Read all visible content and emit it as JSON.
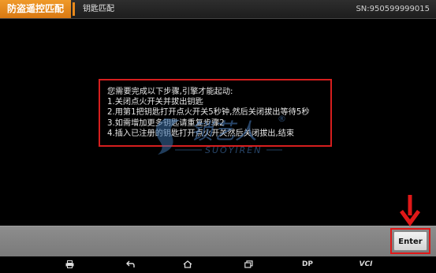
{
  "header": {
    "app_title": "防盗遥控匹配",
    "breadcrumb": "钥匙匹配",
    "serial": "SN:950599999015"
  },
  "dialog": {
    "lines": [
      "您需要完成以下步骤,引擎才能起动:",
      "1.关闭点火开关并拔出钥匙",
      "2.用第1把钥匙打开点火开关5秒钟,然后关闭拔出等待5秒",
      "3.如需增加更多钥匙请重复步骤2",
      "4.插入已注册的钥匙打开点火开关然后关闭拔出,结束"
    ]
  },
  "watermark": {
    "text": "锁艺人",
    "subtext": "SUOYIREN",
    "mark": "®"
  },
  "footer": {
    "enter_label": "Enter"
  },
  "navbar": {
    "dp_label": "DP",
    "vci_label": "VCI"
  },
  "colors": {
    "accent": "#e8891b",
    "highlight_red": "#d61e1e"
  }
}
